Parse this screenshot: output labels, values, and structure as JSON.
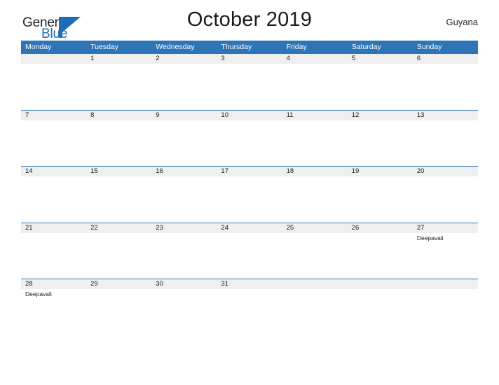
{
  "brand": {
    "name_part1": "General",
    "name_part2": "Blue",
    "mark_icon": "triangle-flag-icon",
    "color_primary": "#1f6eb5",
    "color_text": "#231f20"
  },
  "header": {
    "title": "October 2019",
    "country": "Guyana"
  },
  "theme": {
    "header_blue": "#2e75b6",
    "strip_gray": "#efefef",
    "separator_blue": "#2e75b6",
    "text_dark": "#1a1a1a",
    "background": "#ffffff"
  },
  "calendar": {
    "month": "October",
    "year": "2019",
    "weekday_headers": [
      "Monday",
      "Tuesday",
      "Wednesday",
      "Thursday",
      "Friday",
      "Saturday",
      "Sunday"
    ],
    "weeks": [
      {
        "days": [
          {
            "num": "",
            "event": ""
          },
          {
            "num": "1",
            "event": ""
          },
          {
            "num": "2",
            "event": ""
          },
          {
            "num": "3",
            "event": ""
          },
          {
            "num": "4",
            "event": ""
          },
          {
            "num": "5",
            "event": ""
          },
          {
            "num": "6",
            "event": ""
          }
        ]
      },
      {
        "days": [
          {
            "num": "7",
            "event": ""
          },
          {
            "num": "8",
            "event": ""
          },
          {
            "num": "9",
            "event": ""
          },
          {
            "num": "10",
            "event": ""
          },
          {
            "num": "11",
            "event": ""
          },
          {
            "num": "12",
            "event": ""
          },
          {
            "num": "13",
            "event": ""
          }
        ]
      },
      {
        "days": [
          {
            "num": "14",
            "event": ""
          },
          {
            "num": "15",
            "event": ""
          },
          {
            "num": "16",
            "event": ""
          },
          {
            "num": "17",
            "event": ""
          },
          {
            "num": "18",
            "event": ""
          },
          {
            "num": "19",
            "event": ""
          },
          {
            "num": "20",
            "event": ""
          }
        ]
      },
      {
        "days": [
          {
            "num": "21",
            "event": ""
          },
          {
            "num": "22",
            "event": ""
          },
          {
            "num": "23",
            "event": ""
          },
          {
            "num": "24",
            "event": ""
          },
          {
            "num": "25",
            "event": ""
          },
          {
            "num": "26",
            "event": ""
          },
          {
            "num": "27",
            "event": "Deepavali"
          }
        ]
      },
      {
        "days": [
          {
            "num": "28",
            "event": "Deepavali"
          },
          {
            "num": "29",
            "event": ""
          },
          {
            "num": "30",
            "event": ""
          },
          {
            "num": "31",
            "event": ""
          },
          {
            "num": "",
            "event": ""
          },
          {
            "num": "",
            "event": ""
          },
          {
            "num": "",
            "event": ""
          }
        ]
      }
    ]
  }
}
